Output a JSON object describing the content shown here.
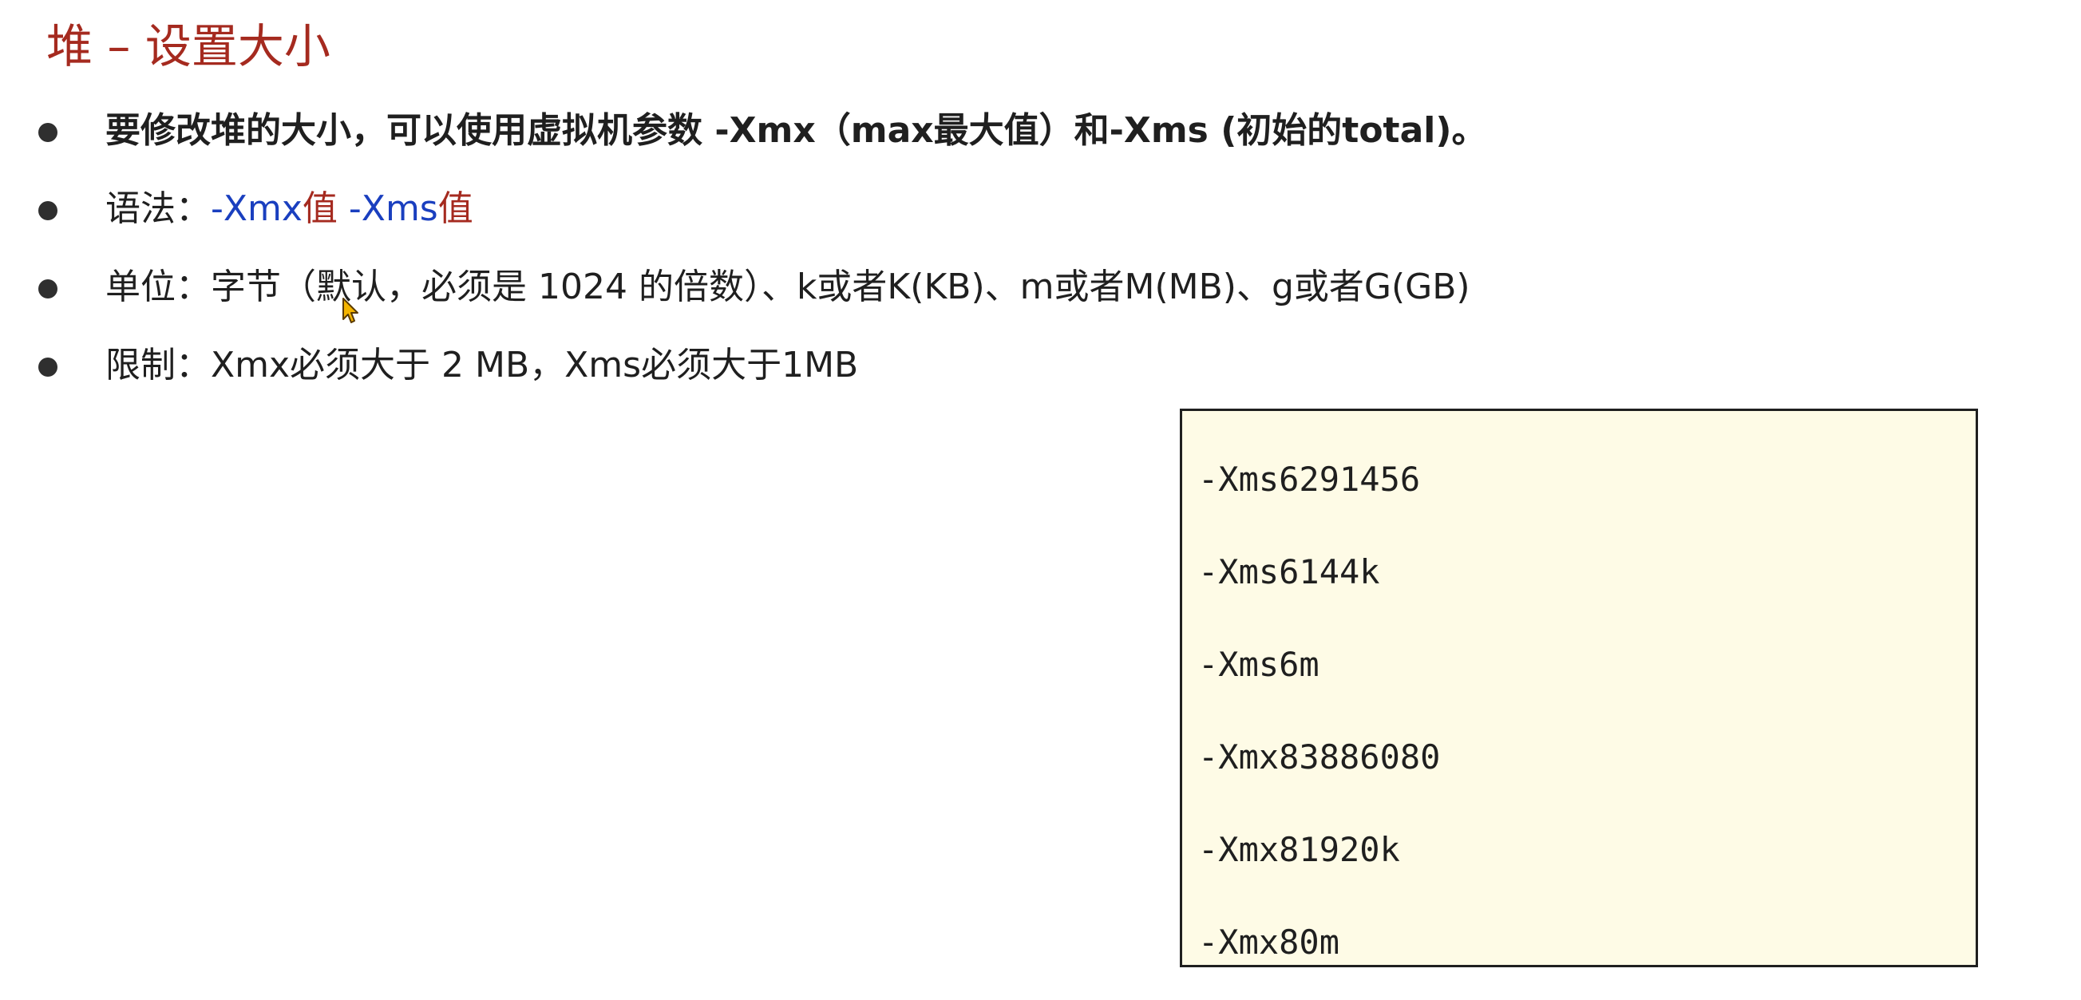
{
  "slide": {
    "title": "堆 – 设置大小",
    "bullets": [
      {
        "text": "要修改堆的大小，可以使用虚拟机参数 -Xmx（max最大值）和-Xms (初始的total)。"
      },
      {
        "label": "语法：",
        "code_xmx": "-Xmx",
        "value1": "值",
        "space": " ",
        "code_xms": "-Xms",
        "value2": "值"
      },
      {
        "text": "单位：字节（默认，必须是 1024 的倍数）、k或者K(KB)、m或者M(MB)、g或者G(GB)"
      },
      {
        "text": "限制：Xmx必须大于 2 MB，Xms必须大于1MB"
      }
    ],
    "examples": [
      "-Xms6291456",
      "-Xms6144k",
      "-Xms6m",
      "-Xmx83886080",
      "-Xmx81920k",
      "-Xmx80m"
    ]
  },
  "colors": {
    "title": "#a52a1f",
    "code_blue": "#1a3fbf",
    "value_red": "#a52a1f",
    "box_bg": "#fefbe6"
  }
}
